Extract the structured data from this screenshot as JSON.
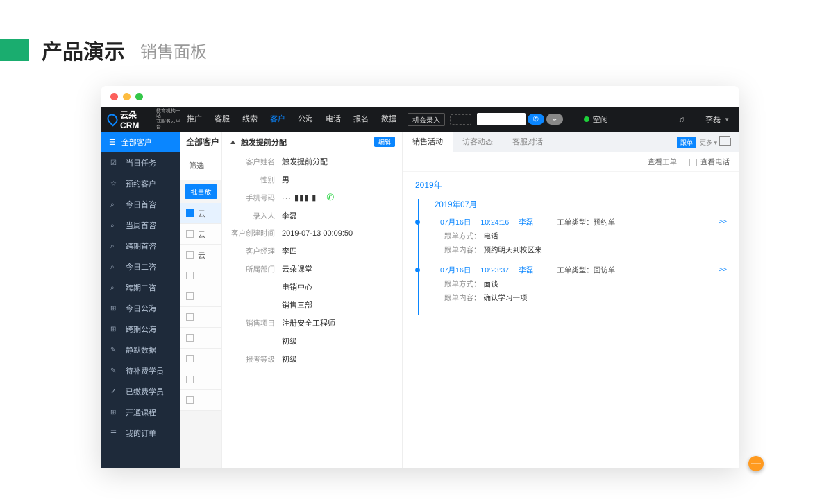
{
  "slide": {
    "title": "产品演示",
    "subtitle": "销售面板"
  },
  "logo": {
    "brand": "云朵CRM",
    "slogan1": "教育机构一站",
    "slogan2": "式服务云平台"
  },
  "nav": {
    "items": [
      "推广",
      "客服",
      "线索",
      "客户",
      "公海",
      "电话",
      "报名",
      "数据"
    ],
    "active_index": 3,
    "entry": "机会录入",
    "status": "空闲",
    "user": "李磊"
  },
  "sidebar": {
    "head": "全部客户",
    "items": [
      "当日任务",
      "预约客户",
      "今日首咨",
      "当周首咨",
      "跨期首咨",
      "今日二咨",
      "跨期二咨",
      "今日公海",
      "跨期公海",
      "静默数据",
      "待补费学员",
      "已缴费学员",
      "开通课程",
      "我的订单"
    ],
    "icons": [
      "☑",
      "☆",
      "⌕",
      "⌕",
      "⌕",
      "⌕",
      "⌕",
      "⊞",
      "⊞",
      "✎",
      "✎",
      "✓",
      "⊞",
      "☰"
    ]
  },
  "list": {
    "header": "全部客户",
    "filter": "筛选",
    "batch": "批量放",
    "rows": [
      "云",
      "云",
      "云",
      "",
      "",
      "",
      "",
      "",
      "",
      ""
    ],
    "selected_index": 0
  },
  "detail": {
    "title": "触发提前分配",
    "edit": "编辑",
    "rows": [
      {
        "label": "客户姓名",
        "value": "触发提前分配"
      },
      {
        "label": "性别",
        "value": "男"
      },
      {
        "label": "手机号码",
        "value": "··· ▮▮▮ ▮",
        "phone": true
      },
      {
        "label": "录入人",
        "value": "李磊"
      },
      {
        "label": "客户创建时间",
        "value": "2019-07-13 00:09:50"
      },
      {
        "label": "客户经理",
        "value": "李四"
      },
      {
        "label": "所属部门",
        "value": "云朵课堂"
      },
      {
        "label": "",
        "value": "电销中心"
      },
      {
        "label": "",
        "value": "销售三部"
      },
      {
        "label": "销售项目",
        "value": "注册安全工程师"
      },
      {
        "label": "",
        "value": "初级"
      },
      {
        "label": "报考等级",
        "value": "初级"
      }
    ]
  },
  "activity": {
    "tabs": [
      "销售活动",
      "访客动态",
      "客服对话"
    ],
    "active_tab": 0,
    "followup": "跟单",
    "more": "更多 ▾",
    "filters": [
      {
        "label": "查看工单"
      },
      {
        "label": "查看电话"
      }
    ],
    "year": "2019年",
    "month": "2019年07月",
    "entries": [
      {
        "date": "07月16日",
        "time": "10:24:16",
        "user": "李磊",
        "type_label": "工单类型：",
        "type_value": "预约单",
        "method_label": "跟单方式：",
        "method_value": "电话",
        "content_label": "跟单内容：",
        "content_value": "预约明天到校区来"
      },
      {
        "date": "07月16日",
        "time": "10:23:37",
        "user": "李磊",
        "type_label": "工单类型：",
        "type_value": "回访单",
        "method_label": "跟单方式：",
        "method_value": "面谈",
        "content_label": "跟单内容：",
        "content_value": "确认学习一项"
      }
    ]
  },
  "fab": "—"
}
